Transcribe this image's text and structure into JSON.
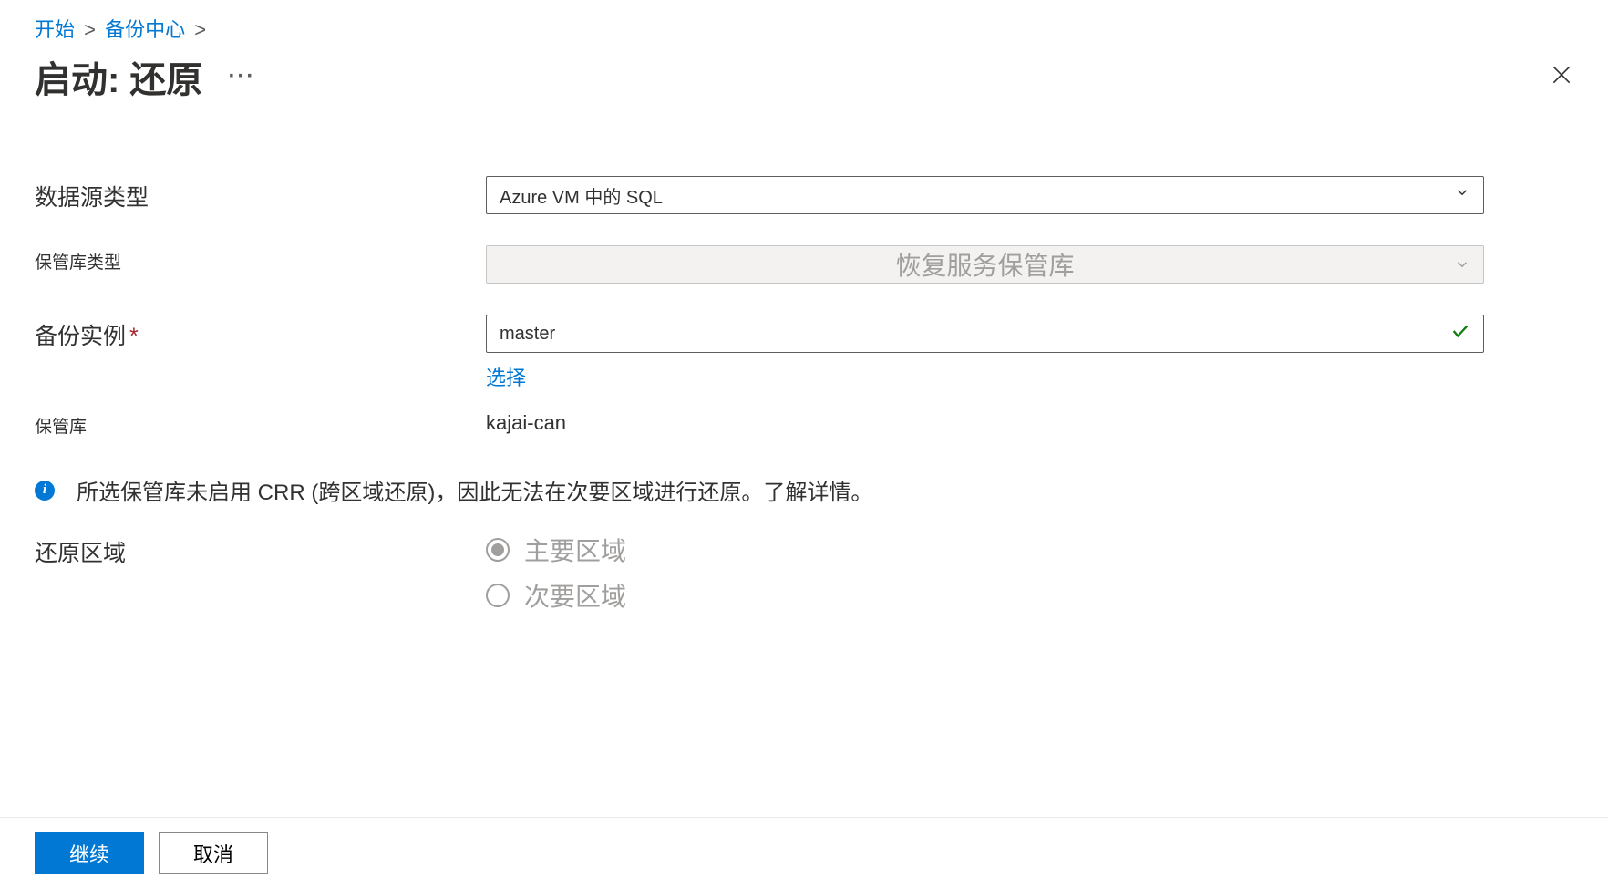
{
  "breadcrumb": {
    "home": "开始",
    "backup_center": "备份中心"
  },
  "page_title": "启动: 还原",
  "labels": {
    "datasource_type": "数据源类型",
    "vault_type": "保管库类型",
    "backup_instance": "备份实例",
    "vault": "保管库",
    "restore_region": "还原区域"
  },
  "fields": {
    "datasource_type_value": "Azure VM 中的 SQL",
    "vault_type_value": "恢复服务保管库",
    "backup_instance_value": "master",
    "select_link": "选择",
    "vault_value": "kajai-can"
  },
  "info_message": "所选保管库未启用 CRR (跨区域还原)，因此无法在次要区域进行还原。了解详情。",
  "radio": {
    "primary": "主要区域",
    "secondary": "次要区域"
  },
  "buttons": {
    "continue": "继续",
    "cancel": "取消"
  }
}
